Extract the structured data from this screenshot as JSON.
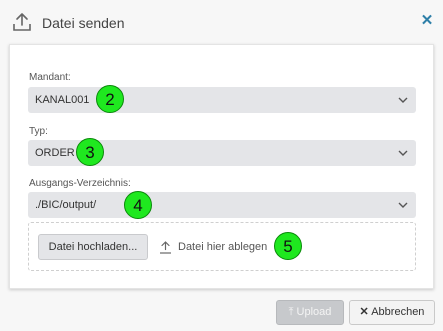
{
  "dialog": {
    "title": "Datei senden",
    "close_icon": "close-icon",
    "header_icon": "upload-icon"
  },
  "form": {
    "mandant": {
      "label": "Mandant:",
      "value": "KANAL001",
      "badge": "2"
    },
    "typ": {
      "label": "Typ:",
      "value": "ORDER",
      "badge": "3"
    },
    "ausgang": {
      "label": "Ausgangs-Verzeichnis:",
      "value": "./BIC/output/",
      "badge": "4"
    },
    "dropzone": {
      "button_label": "Datei hochladen...",
      "hint": "Datei hier ablegen",
      "badge": "5"
    }
  },
  "footer": {
    "upload_label": "Upload",
    "cancel_label": "Abbrechen"
  },
  "colors": {
    "accent": "#2e7fa8",
    "badge": "#1fe81f",
    "select_bg": "#e4e5e8"
  }
}
